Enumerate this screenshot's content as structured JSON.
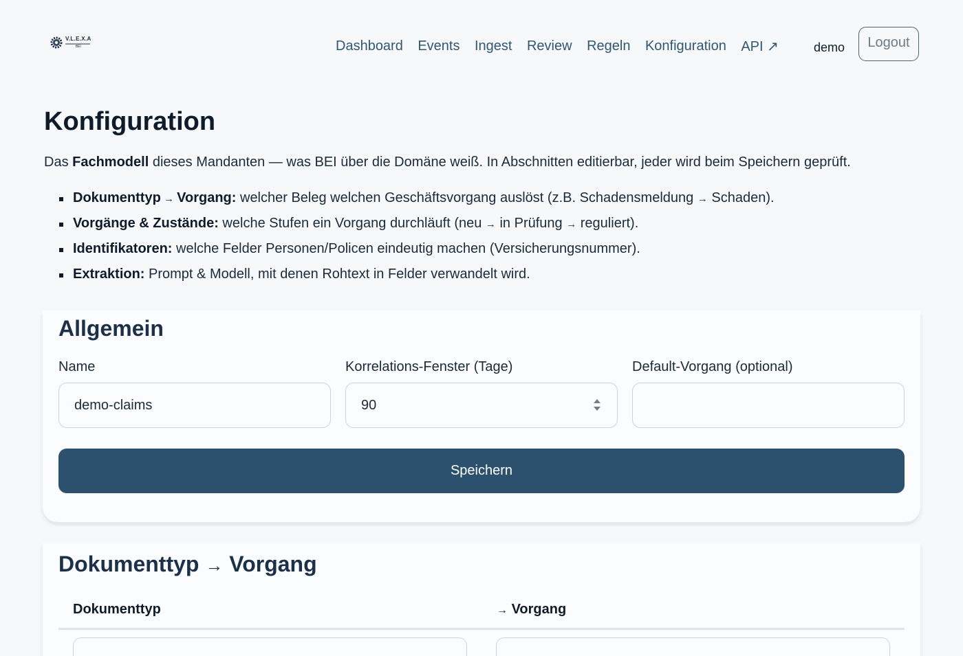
{
  "brand": {
    "logo_text": "V.L.E.X.A",
    "logo_sub": "BEI"
  },
  "nav": {
    "links": [
      "Dashboard",
      "Events",
      "Ingest",
      "Review",
      "Regeln",
      "Konfiguration",
      "API ↗"
    ],
    "user": "demo",
    "logout": "Logout"
  },
  "page": {
    "title": "Konfiguration",
    "intro_prefix": "Das ",
    "intro_bold": "Fachmodell",
    "intro_suffix": " dieses Mandanten — was BEI über die Domäne weiß. In Abschnitten editierbar, jeder wird beim Speichern geprüft.",
    "bullets": [
      {
        "b1": "Dokumenttyp",
        "arrow1": " → ",
        "b2": "Vorgang:",
        "text": " welcher Beleg welchen Geschäftsvorgang auslöst (z.B. Schadensmeldung ",
        "arrow2": "→",
        "text2": " Schaden)."
      },
      {
        "b1": "Vorgänge & Zustände:",
        "text": " welche Stufen ein Vorgang durchläuft (neu ",
        "arrow1": "→",
        "text_mid": " in Prüfung ",
        "arrow2": "→",
        "text2": " reguliert)."
      },
      {
        "b1": "Identifikatoren:",
        "text": " welche Felder Personen/Policen eindeutig machen (Versicherungsnummer)."
      },
      {
        "b1": "Extraktion:",
        "text": " Prompt & Modell, mit denen Rohtext in Felder verwandelt wird."
      }
    ]
  },
  "general": {
    "heading": "Allgemein",
    "name_label": "Name",
    "name_value": "demo-claims",
    "window_label": "Korrelations-Fenster (Tage)",
    "window_value": "90",
    "default_label": "Default-Vorgang (optional)",
    "default_value": "",
    "save_label": "Speichern"
  },
  "doctype": {
    "heading_left": "Dokumenttyp",
    "heading_arrow": "→",
    "heading_right": "Vorgang",
    "col_doctype": "Dokumenttyp",
    "col_arrow": "→",
    "col_vorgang": "Vorgang"
  },
  "colors": {
    "accent": "#2b516f",
    "nav_link": "#2e5774",
    "background": "#f6f8fa"
  }
}
